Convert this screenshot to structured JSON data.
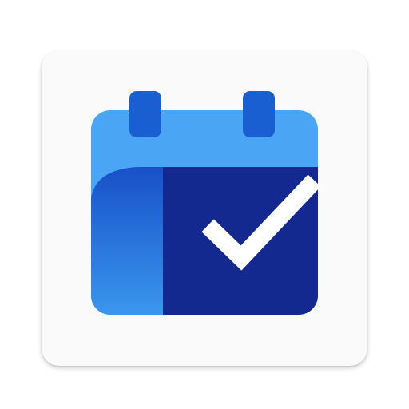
{
  "app_icon": {
    "name": "calendar-check-icon",
    "colors": {
      "tile_background": "#fafafa",
      "calendar_light_blue": "#4aa5f5",
      "calendar_dark_navy": "#13298f",
      "ring_blue": "#1a5fd1",
      "page_fold_gradient_top": "#1850c8",
      "page_fold_gradient_bottom": "#3a97ee",
      "check_mark": "#ffffff"
    }
  }
}
